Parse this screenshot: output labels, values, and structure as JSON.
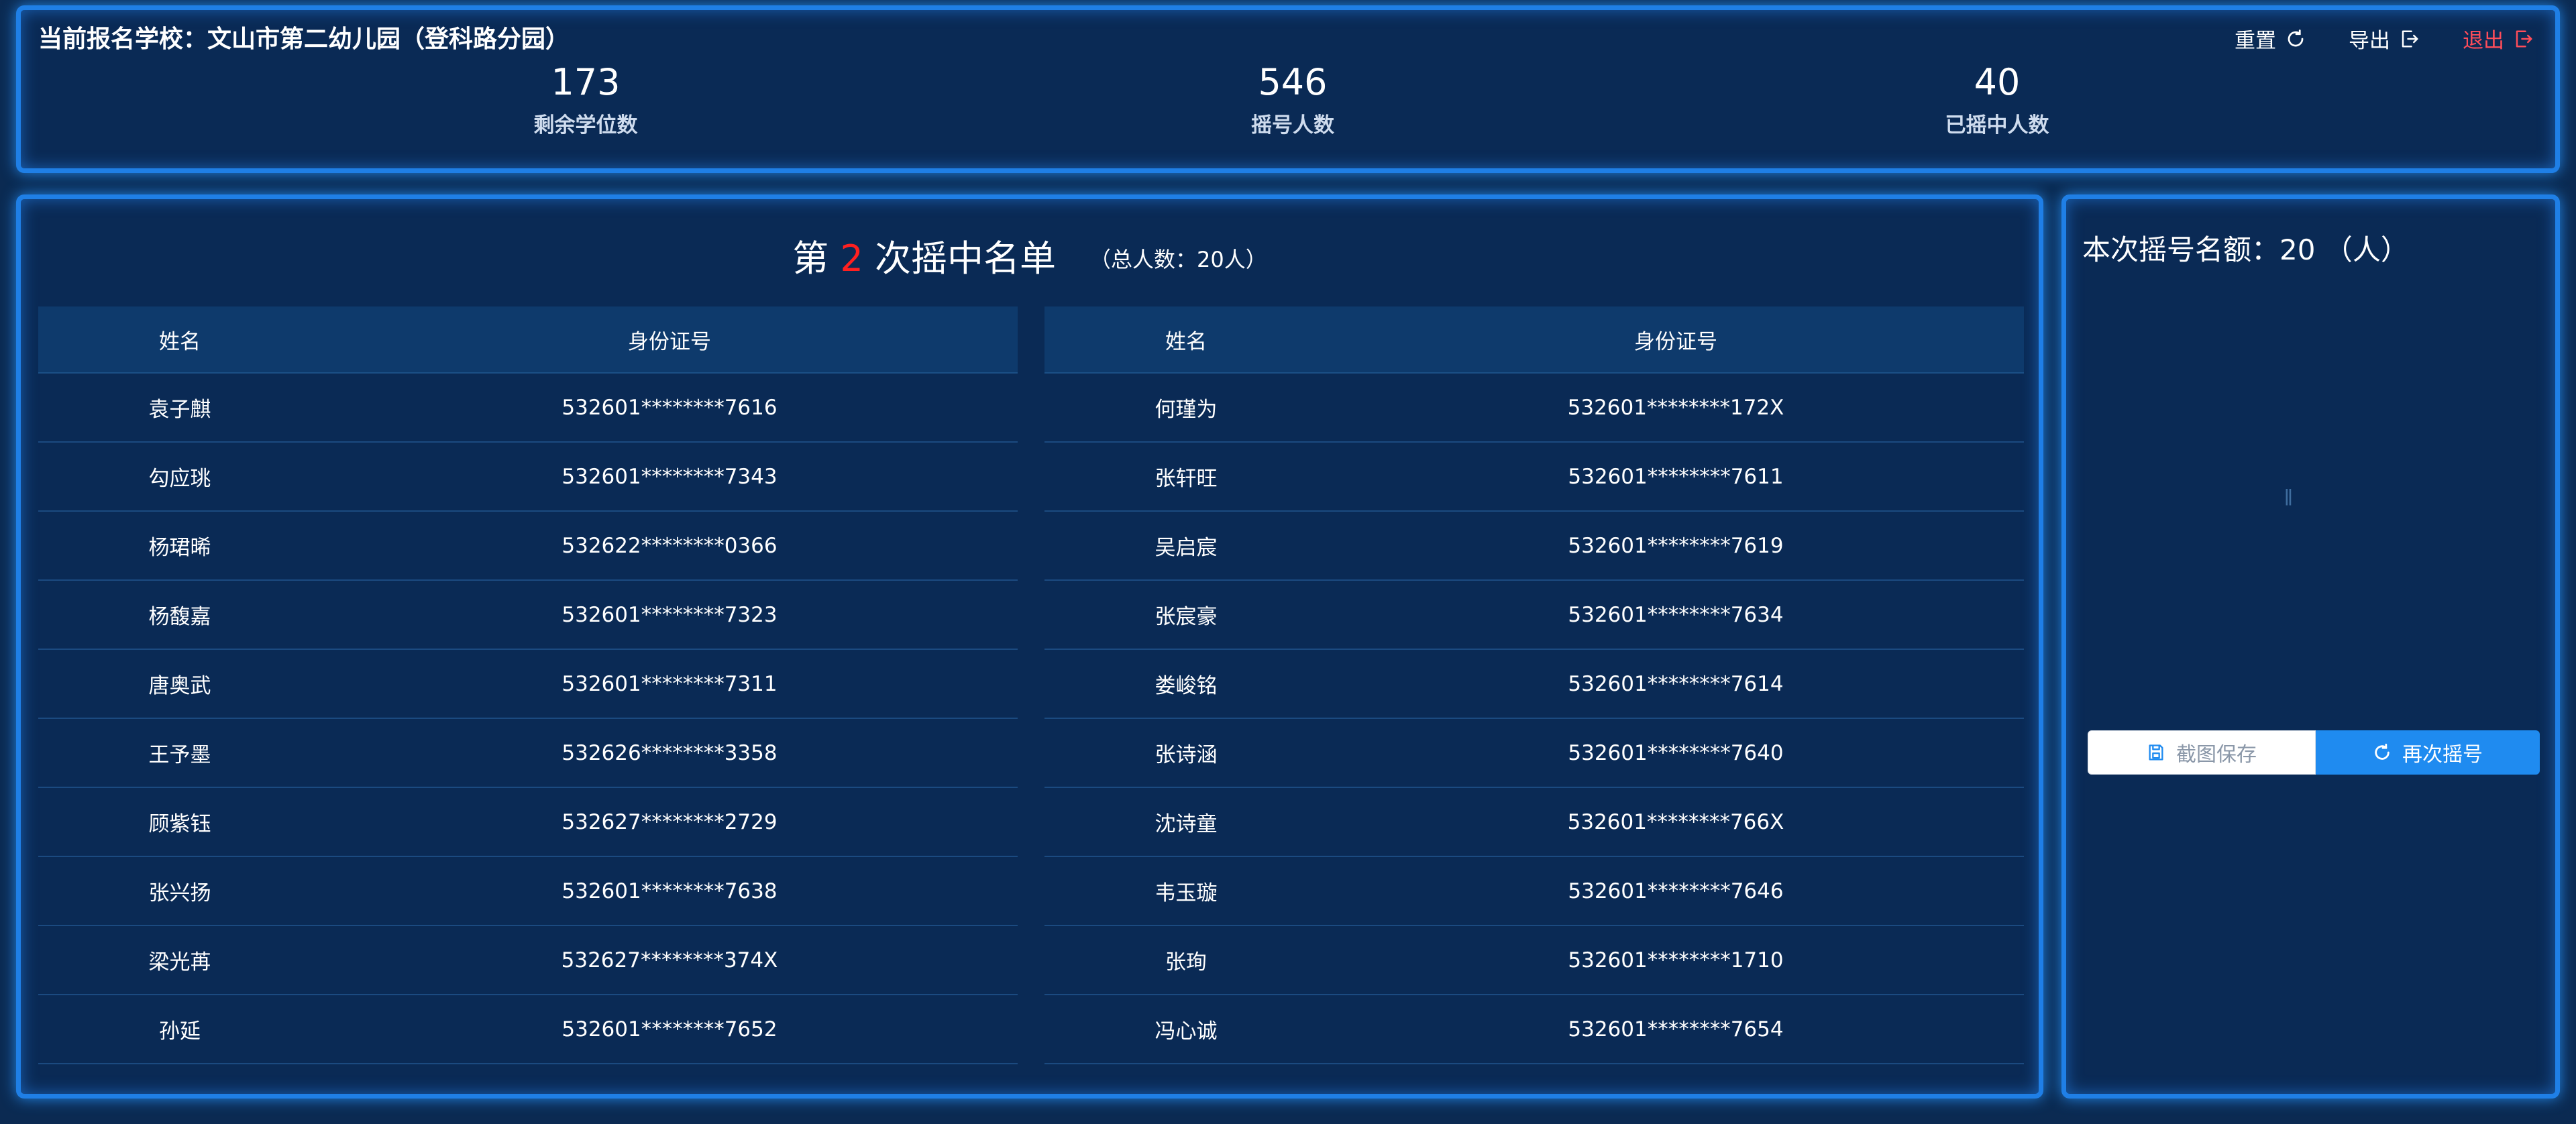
{
  "header": {
    "school_prefix": "当前报名学校：",
    "school_name": "文山市第二幼儿园（登科路分园）",
    "actions": {
      "reset": "重置",
      "export": "导出",
      "logout": "退出"
    }
  },
  "stats": {
    "remaining_seats": {
      "value": "173",
      "label": "剩余学位数"
    },
    "applicants": {
      "value": "546",
      "label": "摇号人数"
    },
    "drawn": {
      "value": "40",
      "label": "已摇中人数"
    }
  },
  "round": {
    "prefix": "第",
    "number": "2",
    "suffix": "次摇中名单",
    "total": "（总人数：20人）"
  },
  "table": {
    "headers": {
      "name": "姓名",
      "id": "身份证号"
    },
    "left": [
      {
        "name": "袁子麒",
        "id": "532601********7616"
      },
      {
        "name": "勾应珧",
        "id": "532601********7343"
      },
      {
        "name": "杨珺晞",
        "id": "532622********0366"
      },
      {
        "name": "杨馥嘉",
        "id": "532601********7323"
      },
      {
        "name": "唐奥武",
        "id": "532601********7311"
      },
      {
        "name": "王予墨",
        "id": "532626********3358"
      },
      {
        "name": "顾紫钰",
        "id": "532627********2729"
      },
      {
        "name": "张兴扬",
        "id": "532601********7638"
      },
      {
        "name": "梁光苒",
        "id": "532627********374X"
      },
      {
        "name": "孙延",
        "id": "532601********7652"
      }
    ],
    "right": [
      {
        "name": "何瑾为",
        "id": "532601********172X"
      },
      {
        "name": "张轩旺",
        "id": "532601********7611"
      },
      {
        "name": "吴启宸",
        "id": "532601********7619"
      },
      {
        "name": "张宸豪",
        "id": "532601********7634"
      },
      {
        "name": "娄峻铭",
        "id": "532601********7614"
      },
      {
        "name": "张诗涵",
        "id": "532601********7640"
      },
      {
        "name": "沈诗童",
        "id": "532601********766X"
      },
      {
        "name": "韦玉璇",
        "id": "532601********7646"
      },
      {
        "name": "张珣",
        "id": "532601********1710"
      },
      {
        "name": "冯心诚",
        "id": "532601********7654"
      }
    ]
  },
  "side": {
    "quota_label": "本次摇号名额：",
    "quota_value": "20",
    "quota_unit": "（人）",
    "faint_mark": "ǁ",
    "save_label": "截图保存",
    "redraw_label": "再次摇号"
  },
  "colors": {
    "accent": "#1f8bf0",
    "panel_border": "#1f7fe6",
    "danger": "#ff4d5a",
    "highlight": "#ff2020"
  }
}
